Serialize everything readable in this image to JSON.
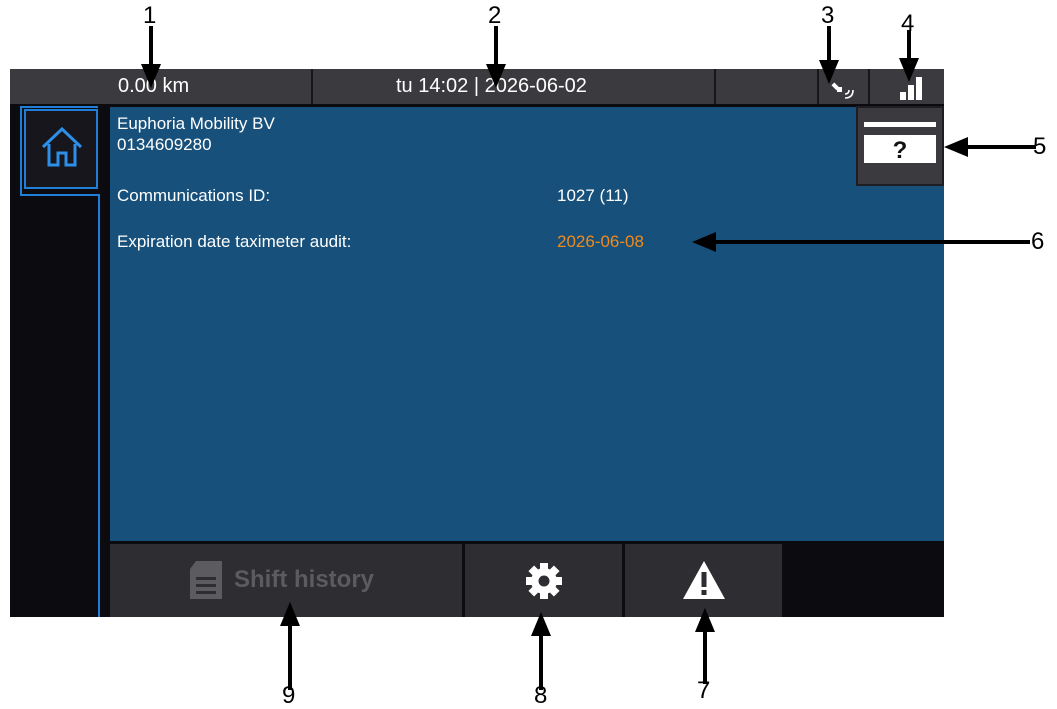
{
  "status_bar": {
    "distance": "0.00 km",
    "datetime": "tu 14:02 | 2026-06-02",
    "gps_icon": "gps-signal-icon",
    "signal_icon": "cellular-signal-icon"
  },
  "company": {
    "name": "Euphoria Mobility BV",
    "number": "0134609280"
  },
  "info": {
    "communications_label": "Communications ID:",
    "communications_value": "1027 (11)",
    "expiration_label": "Expiration date taximeter audit:",
    "expiration_value": "2026-06-08"
  },
  "buttons": {
    "card_help_icon": "card-question-icon",
    "shift_history_label": "Shift history",
    "settings_icon": "gear-icon",
    "warning_icon": "warning-icon",
    "home_icon": "home-icon"
  },
  "callouts": [
    "1",
    "2",
    "3",
    "4",
    "5",
    "6",
    "7",
    "8",
    "9"
  ],
  "colors": {
    "panel": "#17507a",
    "accent_blue": "#1f7fd6",
    "expiry_orange": "#f08a1c",
    "status_bar": "#3b3b3f"
  }
}
